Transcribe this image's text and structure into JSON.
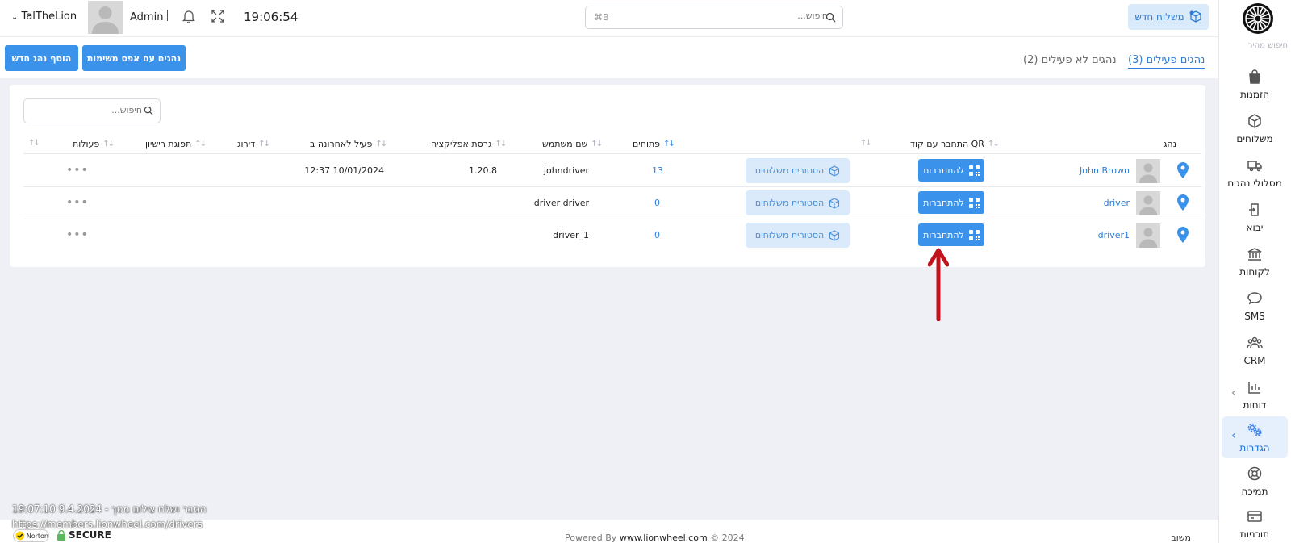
{
  "header": {
    "new_shipment": "משלוח חדש",
    "search_placeholder": "חיפוש...",
    "search_shortcut": "⌘B",
    "user": "TalTheLion",
    "role": "Admin",
    "clock": "19:06:54"
  },
  "sidebar": {
    "quick_search": "חיפוש מהיר",
    "items": [
      {
        "label": "הזמנות",
        "icon": "shopping-bag-icon"
      },
      {
        "label": "משלוחים",
        "icon": "package-icon"
      },
      {
        "label": "מסלולי נהגים",
        "icon": "truck-icon"
      },
      {
        "label": "יבוא",
        "icon": "import-icon"
      },
      {
        "label": "לקוחות",
        "icon": "bank-icon"
      },
      {
        "label": "SMS",
        "icon": "chat-bubble-icon"
      },
      {
        "label": "CRM",
        "icon": "users-icon"
      },
      {
        "label": "דוחות",
        "icon": "chart-icon"
      },
      {
        "label": "הגדרות",
        "icon": "gears-icon"
      },
      {
        "label": "תמיכה",
        "icon": "lifebuoy-icon"
      },
      {
        "label": "תוכניות",
        "icon": "credit-card-icon"
      }
    ]
  },
  "subheader": {
    "add_driver": "הוסף נהג חדש",
    "zero_tasks": "נהגים עם אפס משימות",
    "tab_active": "נהגים פעילים (3)",
    "tab_inactive": "נהגים לא פעילים (2)"
  },
  "table": {
    "search_placeholder": "חיפוש...",
    "columns": {
      "driver": "נהג",
      "qr": "התחבר עם קוד QR",
      "opens": "פתוחים",
      "username": "שם משתמש",
      "app_version": "גרסת אפליקציה",
      "last_active": "פעיל לאחרונה ב",
      "rating": "דירוג",
      "license_expiry": "תפוגת רישיון",
      "actions": "פעולות"
    },
    "connect_label": "להתחברות",
    "history_label": "הסטורית משלוחים",
    "actions_dots": "•••",
    "rows": [
      {
        "driver": "John Brown",
        "opens": "13",
        "username": "johndriver",
        "app_version": "1.20.8",
        "last_active": "12:37 10/01/2024"
      },
      {
        "driver": "driver",
        "opens": "0",
        "username": "driver driver",
        "app_version": "",
        "last_active": ""
      },
      {
        "driver": "driver1",
        "opens": "0",
        "username": "driver_1",
        "app_version": "",
        "last_active": ""
      }
    ]
  },
  "footer": {
    "powered_by": "Powered By",
    "site": "www.lionwheel.com",
    "copyright": "© 2024",
    "right_text": "משוב",
    "overlay_timestamp": "הסבר ושלח צילום מסך - 9.4.2024 19:07:10",
    "overlay_url": "https://members.lionwheel.com/drivers",
    "norton": "Norton",
    "secure": "SECURE"
  },
  "colors": {
    "accent": "#3a92ea",
    "light_accent": "#dbeafb",
    "arrow": "#c0141c"
  }
}
